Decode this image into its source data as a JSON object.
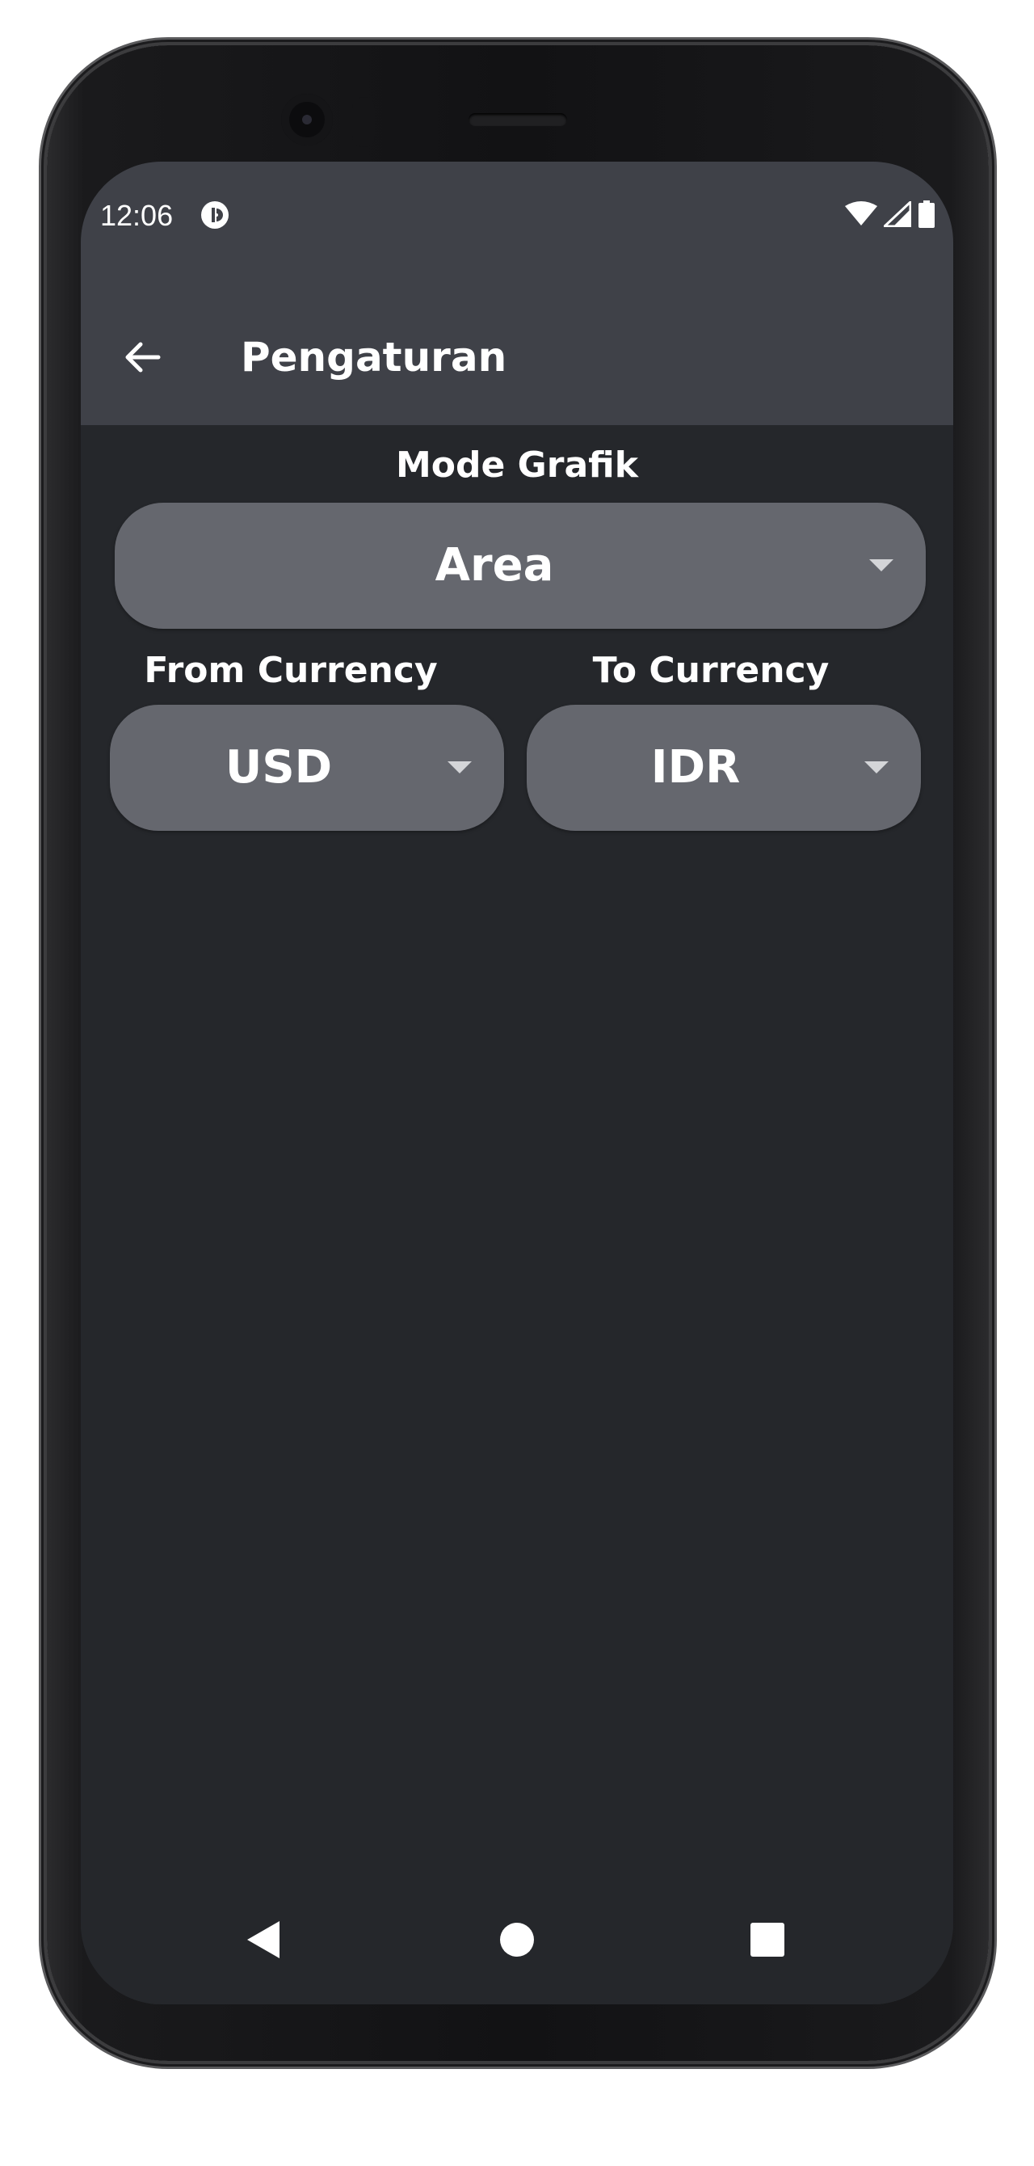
{
  "status_bar": {
    "time": "12:06",
    "app_icon": "pocket-casts-like-icon",
    "icons": [
      "wifi-icon",
      "cellular-signal-icon",
      "battery-icon"
    ]
  },
  "app_bar": {
    "back_icon": "arrow-back-icon",
    "title": "Pengaturan"
  },
  "settings": {
    "chart_mode": {
      "label": "Mode Grafik",
      "selected": "Area"
    },
    "from_currency": {
      "label": "From Currency",
      "selected": "USD"
    },
    "to_currency": {
      "label": "To Currency",
      "selected": "IDR"
    }
  },
  "nav_bar": {
    "icons": [
      "nav-back-icon",
      "nav-home-icon",
      "nav-recents-icon"
    ]
  },
  "colors": {
    "app_bar": "#3f4148",
    "background": "#25272b",
    "dropdown": "#65676e",
    "text": "#ffffff"
  }
}
